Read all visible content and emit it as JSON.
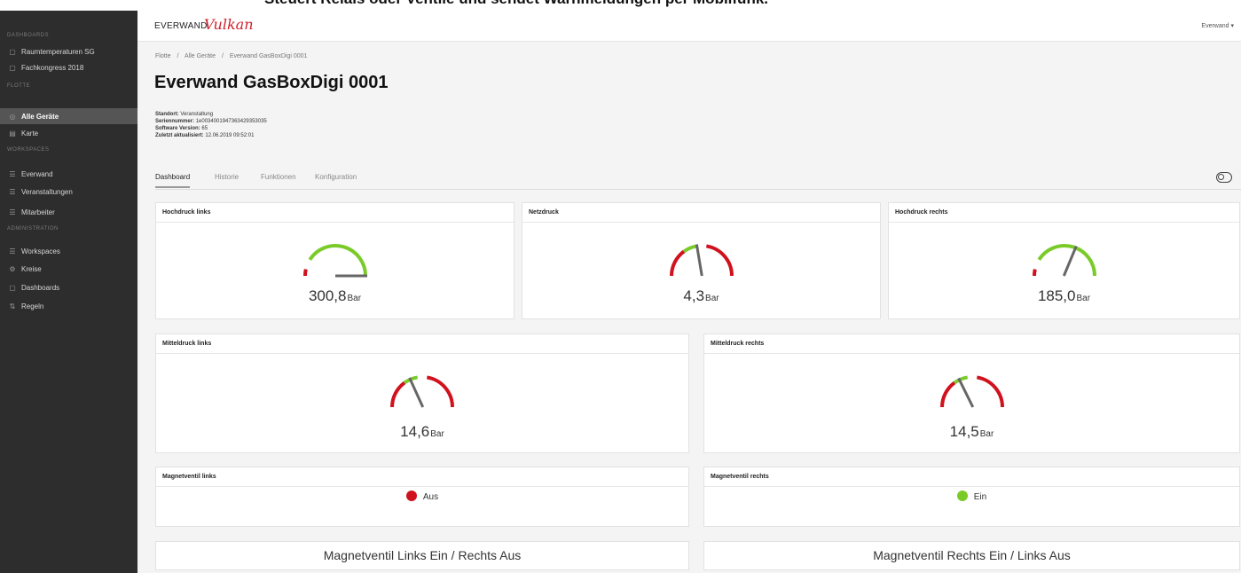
{
  "caption": "Steuert Relais oder Ventile und sendet Warnmeldungen per Mobilfunk.",
  "sidebar": {
    "sections": [
      {
        "title": "Dashboards",
        "items": [
          {
            "icon": "dashboard-icon",
            "label": "Raumtemperaturen SG"
          },
          {
            "icon": "dashboard-icon",
            "label": "Fachkongress 2018"
          }
        ]
      },
      {
        "title": "Flotte",
        "items": [
          {
            "icon": "devices-icon",
            "label": "Alle Geräte",
            "active": true
          },
          {
            "icon": "map-icon",
            "label": "Karte"
          }
        ]
      },
      {
        "title": "Workspaces",
        "items": [
          {
            "icon": "workspace-icon",
            "label": "Everwand"
          },
          {
            "icon": "workspace-icon",
            "label": "Veranstaltungen"
          },
          {
            "icon": "workspace-icon",
            "label": "Mitarbeiter"
          }
        ]
      },
      {
        "title": "Administration",
        "items": [
          {
            "icon": "workspace-icon",
            "label": "Workspaces"
          },
          {
            "icon": "gear-icon",
            "label": "Kreise"
          },
          {
            "icon": "dashboard-icon",
            "label": "Dashboards"
          },
          {
            "icon": "rules-icon",
            "label": "Regeln"
          }
        ]
      }
    ]
  },
  "topbar": {
    "logo_everwand": "EVERWAND",
    "logo_vulkan": "Vulkan",
    "user_menu": "Everwand ▾"
  },
  "breadcrumb": {
    "items": [
      "Flotte",
      "Alle Geräte",
      "Everwand GasBoxDigi 0001"
    ],
    "separator": "/"
  },
  "title": "Everwand GasBoxDigi 0001",
  "meta": {
    "standort_label": "Standort:",
    "standort": "Veranstaltung",
    "serien_label": "Seriennummer:",
    "serien": "1e0034001947363429353035",
    "software_label": "Software Version:",
    "software": "65",
    "updated_label": "Zuletzt aktualisiert:",
    "updated": "12.06.2019 09:52:01"
  },
  "tabs": [
    "Dashboard",
    "Historie",
    "Funktionen",
    "Konfiguration"
  ],
  "gauges": [
    {
      "title": "Hochdruck links",
      "value": "300,8",
      "unit": "Bar",
      "fraction": 1.0,
      "zones": "high-ok"
    },
    {
      "title": "Netzdruck",
      "value": "4,3",
      "unit": "Bar",
      "fraction": 0.45,
      "zones": "mid-ok"
    },
    {
      "title": "Hochdruck rechts",
      "value": "185,0",
      "unit": "Bar",
      "fraction": 0.62,
      "zones": "high-ok"
    },
    {
      "title": "Mitteldruck links",
      "value": "14,6",
      "unit": "Bar",
      "fraction": 0.37,
      "zones": "mid-ok"
    },
    {
      "title": "Mitteldruck rechts",
      "value": "14,5",
      "unit": "Bar",
      "fraction": 0.36,
      "zones": "mid-ok"
    }
  ],
  "valves": [
    {
      "title": "Magnetventil links",
      "state": "Aus",
      "color": "#d0121e"
    },
    {
      "title": "Magnetventil rechts",
      "state": "Ein",
      "color": "#7acb2a"
    }
  ],
  "buttons": [
    "Magnetventil Links Ein / Rechts Aus",
    "Magnetventil Rechts Ein / Links Aus"
  ],
  "colors": {
    "sidebar_bg": "#2d2d2d",
    "gauge_green": "#7acb2a",
    "gauge_red": "#d0121e",
    "needle": "#666666"
  }
}
